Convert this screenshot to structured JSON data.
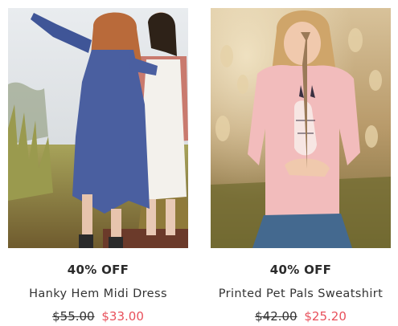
{
  "products": [
    {
      "image_alt": "Two girls in a field",
      "discount": "40% OFF",
      "name": "Hanky Hem Midi Dress",
      "was_price": "$55.00",
      "now_price": "$33.00"
    },
    {
      "image_alt": "Girl holding a dried flower",
      "discount": "40% OFF",
      "name": "Printed Pet Pals Sweatshirt",
      "was_price": "$42.00",
      "now_price": "$25.20"
    }
  ],
  "colors": {
    "sale_price": "#e8505b",
    "text": "#2b2b2b"
  }
}
